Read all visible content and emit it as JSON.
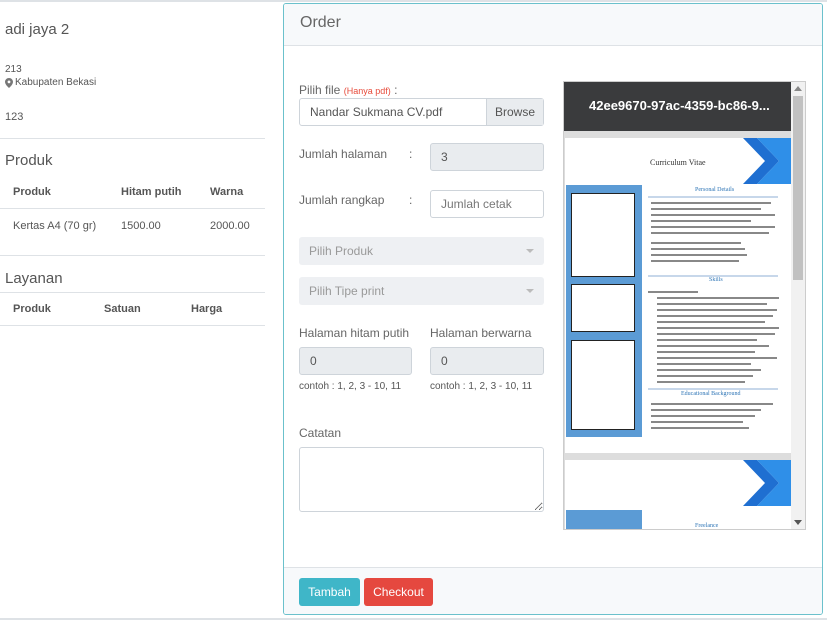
{
  "store": {
    "name": "adi jaya 2",
    "code": "213",
    "location": "Kabupaten Bekasi",
    "number": "123"
  },
  "produk": {
    "title": "Produk",
    "headers": [
      "Produk",
      "Hitam putih",
      "Warna"
    ],
    "rows": [
      {
        "name": "Kertas A4 (70 gr)",
        "bw": "1500.00",
        "color": "2000.00"
      }
    ]
  },
  "layanan": {
    "title": "Layanan",
    "headers": [
      "Produk",
      "Satuan",
      "Harga"
    ]
  },
  "modal": {
    "title": "Order",
    "file": {
      "label": "Pilih file",
      "note": "(Hanya pdf)",
      "colon": ":",
      "value": "Nandar Sukmana CV.pdf",
      "browse": "Browse"
    },
    "jumlah_halaman": {
      "label": "Jumlah halaman",
      "colon": ":",
      "value": "3"
    },
    "jumlah_rangkap": {
      "label": "Jumlah rangkap",
      "colon": ":",
      "placeholder": "Jumlah cetak"
    },
    "pilih_produk": "Pilih Produk",
    "pilih_tipe": "Pilih Tipe print",
    "halaman_hitam": {
      "label": "Halaman hitam putih",
      "value": "0",
      "hint": "contoh : 1, 2, 3 - 10, 11"
    },
    "halaman_warna": {
      "label": "Halaman berwarna",
      "value": "0",
      "hint": "contoh : 1, 2, 3 - 10, 11"
    },
    "catatan": "Catatan",
    "tambah": "Tambah",
    "checkout": "Checkout"
  },
  "pdf": {
    "title": "42ee9670-97ac-4359-bc86-9...",
    "cv_title": "Curriculum Vitae",
    "personal": "Personal Details",
    "skills": "Skills",
    "education": "Educational Background",
    "freelance": "Freelance"
  },
  "colors": {
    "tambah": "#3fb6c8",
    "checkout": "#e5483f",
    "modal_border": "#6bc1cc",
    "cv_blue": "#5b9bd5"
  }
}
